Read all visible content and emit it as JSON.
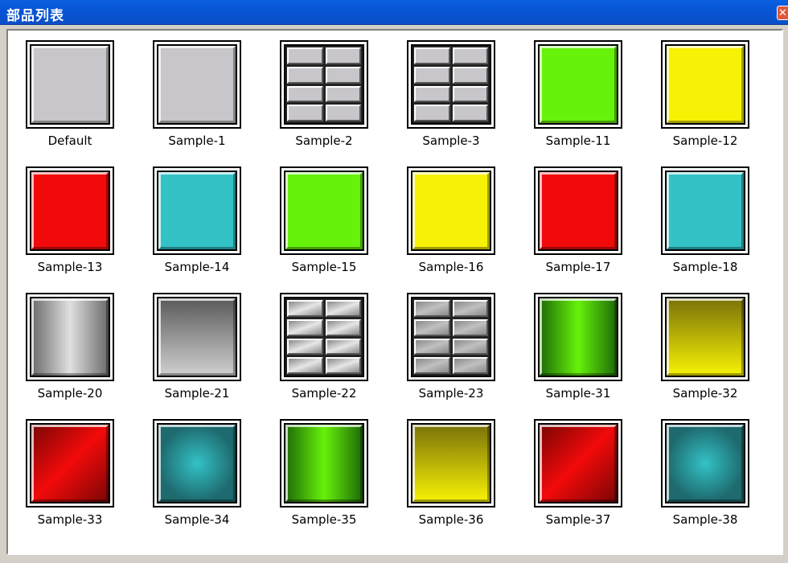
{
  "window": {
    "title": "部品列表",
    "close_label": "✕"
  },
  "items": [
    {
      "label": "Default",
      "style": "flat",
      "c1": "#c8c6ca",
      "c2": "#c8c6ca"
    },
    {
      "label": "Sample-1",
      "style": "flat",
      "c1": "#c8c6ca",
      "c2": "#c8c6ca"
    },
    {
      "label": "Sample-2",
      "style": "bricks",
      "c1": "#c8c6ca",
      "c2": "#c8c6ca"
    },
    {
      "label": "Sample-3",
      "style": "bricks",
      "c1": "#c8c6ca",
      "c2": "#c8c6ca"
    },
    {
      "label": "Sample-11",
      "style": "flat",
      "c1": "#66f20a",
      "c2": "#66f20a"
    },
    {
      "label": "Sample-12",
      "style": "flat",
      "c1": "#f7f205",
      "c2": "#f7f205"
    },
    {
      "label": "Sample-13",
      "style": "flat",
      "c1": "#f20a0a",
      "c2": "#f20a0a"
    },
    {
      "label": "Sample-14",
      "style": "flat",
      "c1": "#33c2c6",
      "c2": "#33c2c6"
    },
    {
      "label": "Sample-15",
      "style": "flat",
      "c1": "#66f20a",
      "c2": "#66f20a"
    },
    {
      "label": "Sample-16",
      "style": "flat",
      "c1": "#f7f205",
      "c2": "#f7f205"
    },
    {
      "label": "Sample-17",
      "style": "flat",
      "c1": "#f20a0a",
      "c2": "#f20a0a"
    },
    {
      "label": "Sample-18",
      "style": "flat",
      "c1": "#33c2c6",
      "c2": "#33c2c6"
    },
    {
      "label": "Sample-20",
      "style": "hcyl",
      "c1": "#6a6a6a",
      "c2": "#e0e0e0"
    },
    {
      "label": "Sample-21",
      "style": "vgrad",
      "c1": "#5a5a5a",
      "c2": "#d0d0d0"
    },
    {
      "label": "Sample-22",
      "style": "bricks",
      "c1": "#8a8a8a",
      "c2": "#e6e6e6"
    },
    {
      "label": "Sample-23",
      "style": "bricks",
      "c1": "#8a8a8a",
      "c2": "#c0c0c0"
    },
    {
      "label": "Sample-31",
      "style": "hcyl",
      "c1": "#1e6a08",
      "c2": "#66f20a"
    },
    {
      "label": "Sample-32",
      "style": "vgrad",
      "c1": "#7a7208",
      "c2": "#f7f205"
    },
    {
      "label": "Sample-33",
      "style": "diag",
      "c1": "#7a0505",
      "c2": "#f20a0a"
    },
    {
      "label": "Sample-34",
      "style": "pyramid",
      "c1": "#1e6a6e",
      "c2": "#33c2c6"
    },
    {
      "label": "Sample-35",
      "style": "hcyl",
      "c1": "#1e6a08",
      "c2": "#66f20a"
    },
    {
      "label": "Sample-36",
      "style": "vgrad",
      "c1": "#7a7208",
      "c2": "#f7f205"
    },
    {
      "label": "Sample-37",
      "style": "diag",
      "c1": "#7a0505",
      "c2": "#f20a0a"
    },
    {
      "label": "Sample-38",
      "style": "pyramid",
      "c1": "#1e6a6e",
      "c2": "#33c2c6"
    }
  ]
}
